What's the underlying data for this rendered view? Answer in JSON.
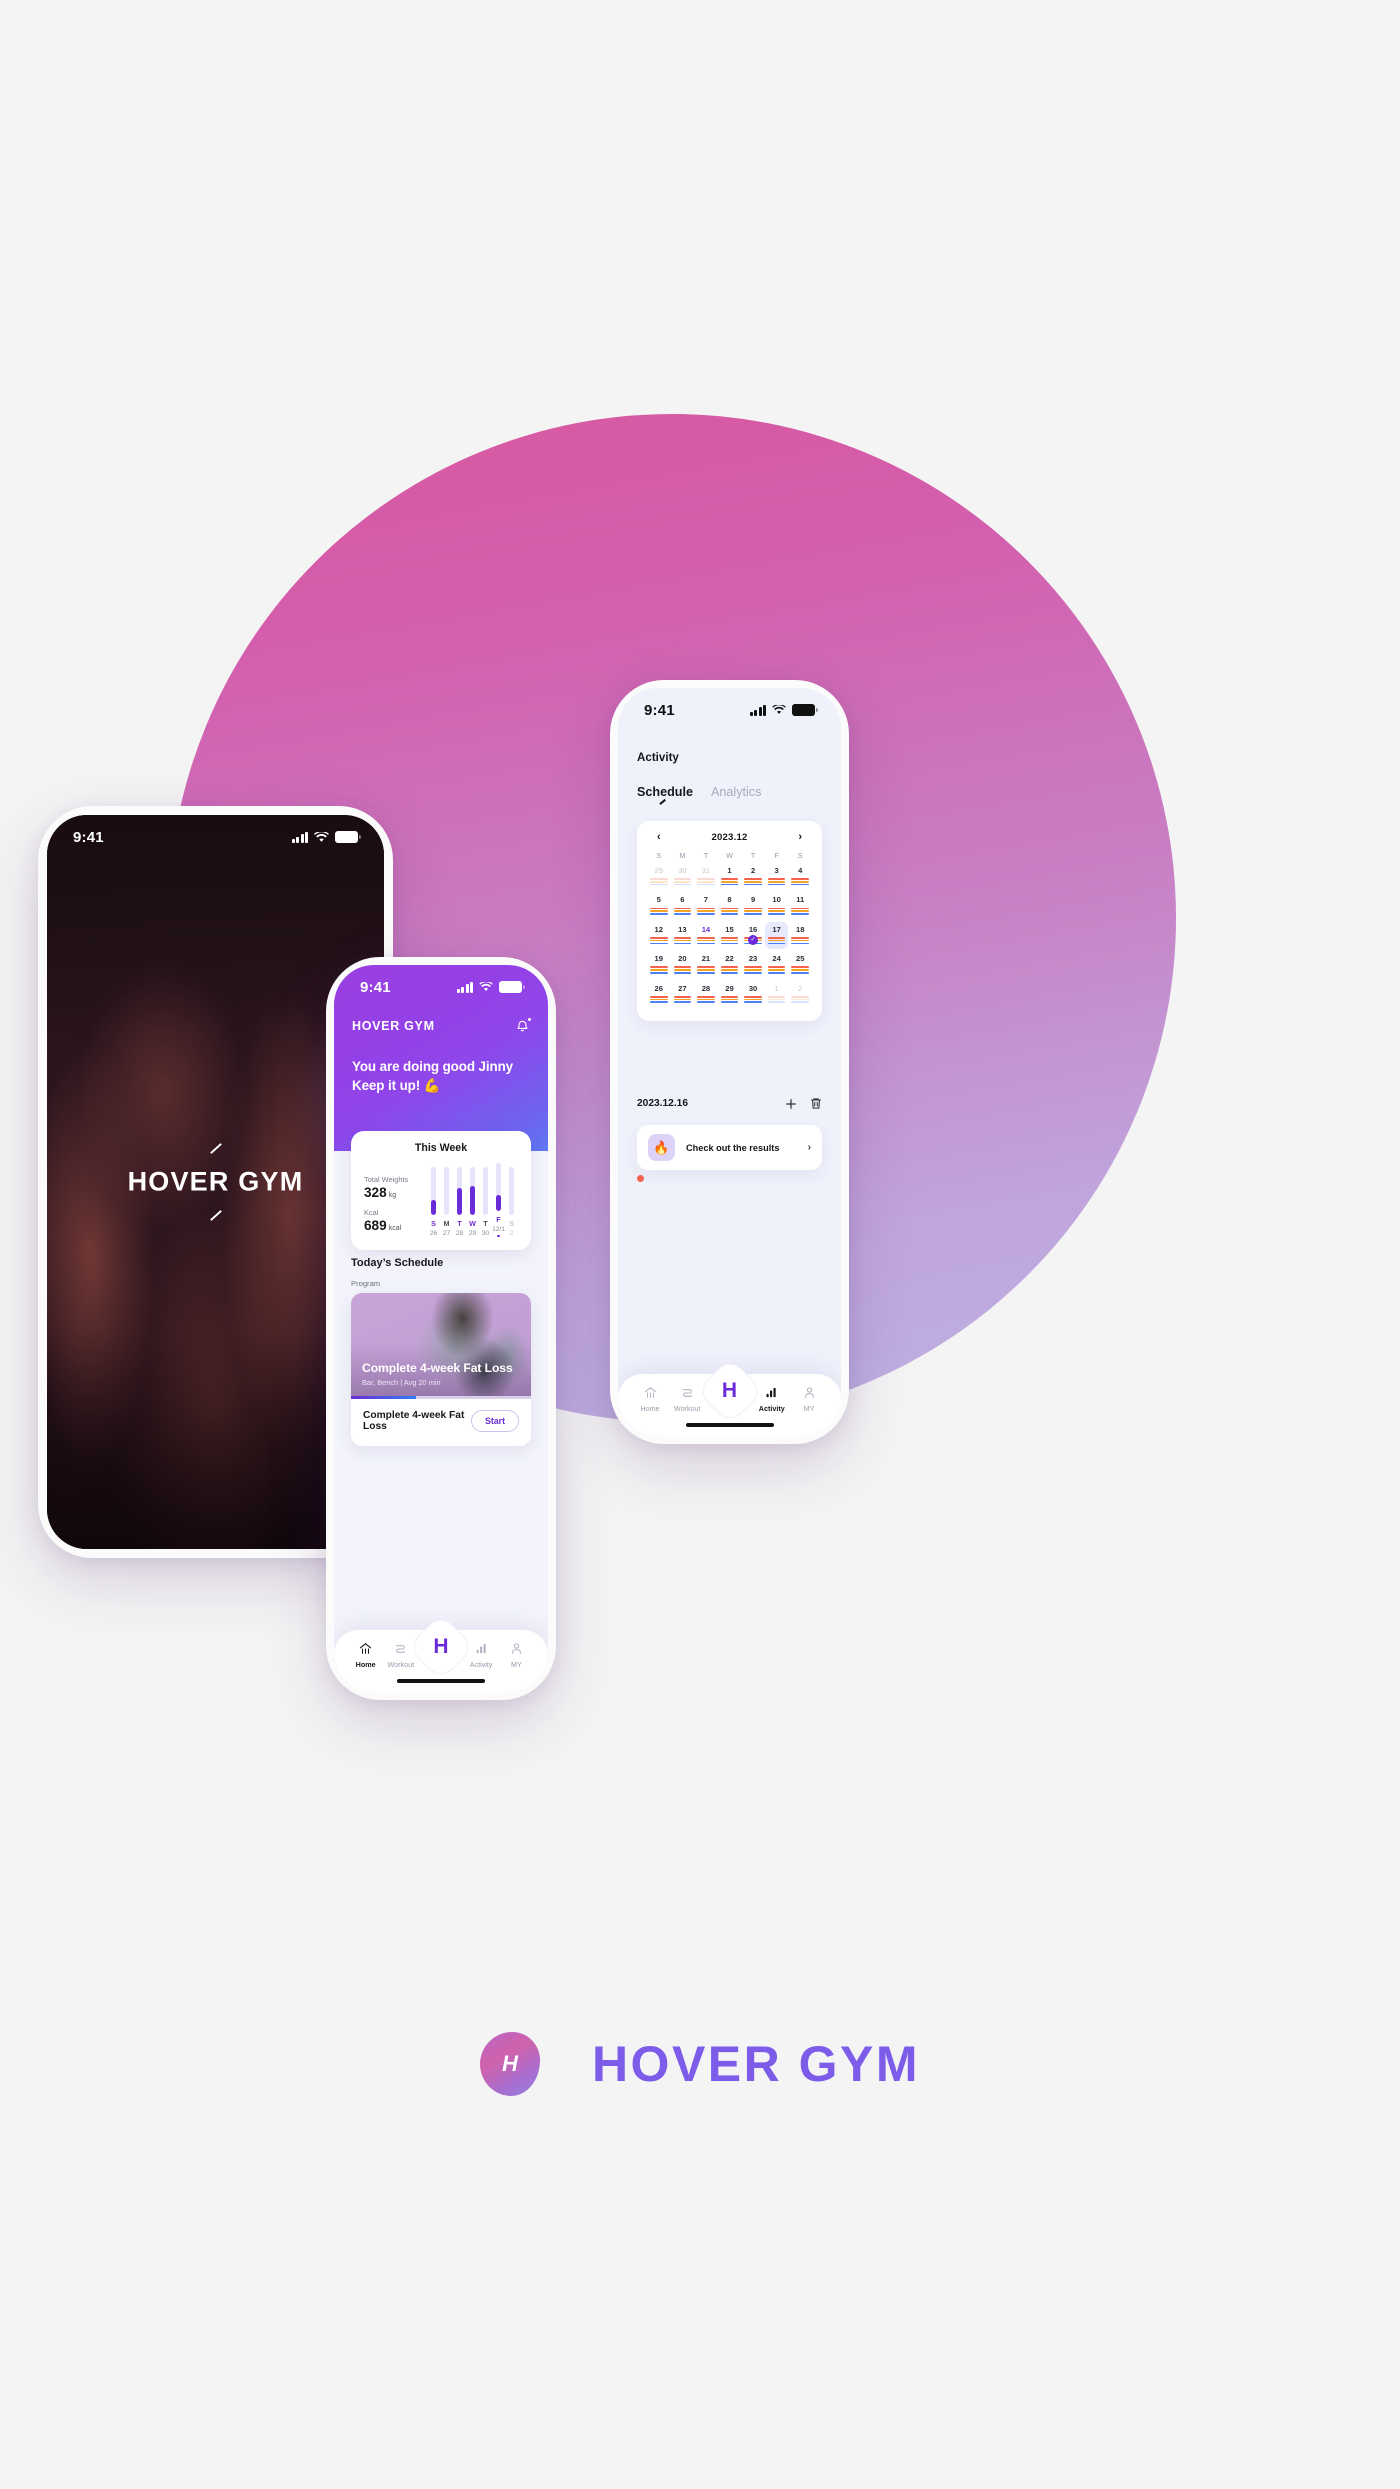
{
  "brand": {
    "name": "HOVER GYM",
    "mark_letter": "H",
    "accent": "#7c5ce8",
    "purple": "#6c2bd9"
  },
  "splash_phone": {
    "status": {
      "time": "9:41",
      "signal_icon": "cellular-signal-icon",
      "wifi_icon": "wifi-icon",
      "battery_icon": "battery-icon"
    },
    "title": "HOVER GYM"
  },
  "home_phone": {
    "status": {
      "time": "9:41"
    },
    "brand": "HOVER GYM",
    "notification_icon": "bell-icon",
    "greeting_line1": "You are doing good Jinny",
    "greeting_line2": "Keep it up! 💪",
    "week_card": {
      "title": "This Week",
      "total_weights_label": "Total Weights",
      "total_weights_value": "328",
      "total_weights_unit": "kg",
      "kcal_label": "Kcal",
      "kcal_value": "689",
      "kcal_unit": "kcal"
    },
    "todays_schedule_title": "Today’s Schedule",
    "program_label": "Program",
    "program": {
      "overlay_title": "Complete 4-week Fat Loss",
      "overlay_meta": "Bar, Bench | Avg 20 min",
      "progress_pct": 36,
      "row_title": "Complete 4-week Fat Loss",
      "start_label": "Start"
    },
    "tabs": [
      {
        "label": "Home",
        "icon": "home-icon",
        "active": true
      },
      {
        "label": "Workout",
        "icon": "workout-icon",
        "active": false
      },
      {
        "label": "Activity",
        "icon": "activity-chart-icon",
        "active": false
      },
      {
        "label": "MY",
        "icon": "person-icon",
        "active": false
      }
    ],
    "center_button": "H"
  },
  "activity_phone": {
    "status": {
      "time": "9:41"
    },
    "page_title": "Activity",
    "tabs": [
      {
        "label": "Schedule",
        "active": true
      },
      {
        "label": "Analytics",
        "active": false
      }
    ],
    "calendar": {
      "month_label": "2023.12",
      "prev_icon": "chevron-left-icon",
      "next_icon": "chevron-right-icon",
      "dow": [
        "S",
        "M",
        "T",
        "W",
        "T",
        "F",
        "S"
      ],
      "selected_day": 17,
      "checked_day": 16,
      "highlighted_day": 14,
      "weeks": [
        [
          {
            "n": "29",
            "out": true
          },
          {
            "n": "30",
            "out": true
          },
          {
            "n": "31",
            "out": true
          },
          {
            "n": "1"
          },
          {
            "n": "2"
          },
          {
            "n": "3"
          },
          {
            "n": "4"
          }
        ],
        [
          {
            "n": "5"
          },
          {
            "n": "6"
          },
          {
            "n": "7"
          },
          {
            "n": "8"
          },
          {
            "n": "9"
          },
          {
            "n": "10"
          },
          {
            "n": "11"
          }
        ],
        [
          {
            "n": "12"
          },
          {
            "n": "13"
          },
          {
            "n": "14",
            "hl": true
          },
          {
            "n": "15"
          },
          {
            "n": "16",
            "check": true
          },
          {
            "n": "17",
            "sel": true
          },
          {
            "n": "18"
          }
        ],
        [
          {
            "n": "19"
          },
          {
            "n": "20"
          },
          {
            "n": "21"
          },
          {
            "n": "22"
          },
          {
            "n": "23"
          },
          {
            "n": "24"
          },
          {
            "n": "25"
          }
        ],
        [
          {
            "n": "26"
          },
          {
            "n": "27"
          },
          {
            "n": "28"
          },
          {
            "n": "29"
          },
          {
            "n": "30"
          },
          {
            "n": "1",
            "out": true
          },
          {
            "n": "2",
            "out": true
          }
        ]
      ]
    },
    "selected_date": "2023.12.16",
    "add_icon": "plus-icon",
    "delete_icon": "trash-icon",
    "result_item": {
      "icon": "fire-emoji",
      "emoji": "🔥",
      "label": "Check out the results",
      "chevron": "chevron-right-icon"
    },
    "tabs_bottom": [
      {
        "label": "Home",
        "icon": "home-icon",
        "active": false
      },
      {
        "label": "Workout",
        "icon": "workout-icon",
        "active": false
      },
      {
        "label": "Activity",
        "icon": "activity-chart-icon",
        "active": true
      },
      {
        "label": "MY",
        "icon": "person-icon",
        "active": false
      }
    ],
    "center_button": "H"
  },
  "chart_data": {
    "type": "bar",
    "title": "This Week",
    "categories": [
      "S",
      "M",
      "T",
      "W",
      "T",
      "F",
      "S"
    ],
    "tick_labels": [
      "26",
      "27",
      "28",
      "29",
      "30",
      "12/1",
      "2"
    ],
    "values": [
      32,
      0,
      58,
      62,
      0,
      34,
      0
    ],
    "ylim": [
      0,
      100
    ],
    "ylabel": "",
    "xlabel": "",
    "grid": false,
    "legend": "none",
    "annotations": [
      "Total Weights 328 kg",
      "Kcal 689 kcal"
    ]
  }
}
